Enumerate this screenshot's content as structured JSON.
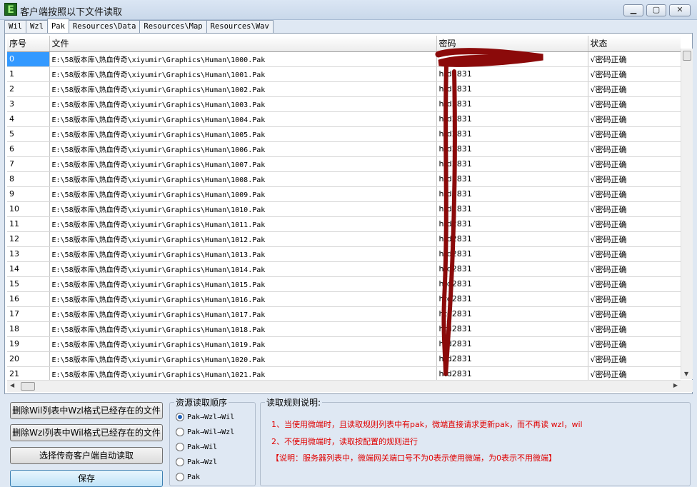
{
  "window": {
    "title": "客户端按照以下文件读取",
    "icon_letter": "E",
    "minimize_icon": "minimize-icon",
    "maximize_icon": "maximize-icon",
    "close_icon": "close-icon"
  },
  "tabs": [
    {
      "label": "Wil"
    },
    {
      "label": "Wzl"
    },
    {
      "label": "Pak",
      "active": true
    },
    {
      "label": "Resources\\Data"
    },
    {
      "label": "Resources\\Map"
    },
    {
      "label": "Resources\\Wav"
    }
  ],
  "grid": {
    "columns": [
      "序号",
      "文件",
      "密码",
      "状态"
    ],
    "rows": [
      {
        "idx": "0",
        "file": "E:\\58版本库\\热血传奇\\xiyumir\\Graphics\\Human\\1000.Pak",
        "pwd": "",
        "status": "√密码正确"
      },
      {
        "idx": "1",
        "file": "E:\\58版本库\\热血传奇\\xiyumir\\Graphics\\Human\\1001.Pak",
        "pwd": "htd2831",
        "status": "√密码正确"
      },
      {
        "idx": "2",
        "file": "E:\\58版本库\\热血传奇\\xiyumir\\Graphics\\Human\\1002.Pak",
        "pwd": "htd2831",
        "status": "√密码正确"
      },
      {
        "idx": "3",
        "file": "E:\\58版本库\\热血传奇\\xiyumir\\Graphics\\Human\\1003.Pak",
        "pwd": "htd2831",
        "status": "√密码正确"
      },
      {
        "idx": "4",
        "file": "E:\\58版本库\\热血传奇\\xiyumir\\Graphics\\Human\\1004.Pak",
        "pwd": "htd2831",
        "status": "√密码正确"
      },
      {
        "idx": "5",
        "file": "E:\\58版本库\\热血传奇\\xiyumir\\Graphics\\Human\\1005.Pak",
        "pwd": "htd2831",
        "status": "√密码正确"
      },
      {
        "idx": "6",
        "file": "E:\\58版本库\\热血传奇\\xiyumir\\Graphics\\Human\\1006.Pak",
        "pwd": "htd2831",
        "status": "√密码正确"
      },
      {
        "idx": "7",
        "file": "E:\\58版本库\\热血传奇\\xiyumir\\Graphics\\Human\\1007.Pak",
        "pwd": "htd2831",
        "status": "√密码正确"
      },
      {
        "idx": "8",
        "file": "E:\\58版本库\\热血传奇\\xiyumir\\Graphics\\Human\\1008.Pak",
        "pwd": "htd2831",
        "status": "√密码正确"
      },
      {
        "idx": "9",
        "file": "E:\\58版本库\\热血传奇\\xiyumir\\Graphics\\Human\\1009.Pak",
        "pwd": "htd2831",
        "status": "√密码正确"
      },
      {
        "idx": "10",
        "file": "E:\\58版本库\\热血传奇\\xiyumir\\Graphics\\Human\\1010.Pak",
        "pwd": "htd2831",
        "status": "√密码正确"
      },
      {
        "idx": "11",
        "file": "E:\\58版本库\\热血传奇\\xiyumir\\Graphics\\Human\\1011.Pak",
        "pwd": "htd2831",
        "status": "√密码正确"
      },
      {
        "idx": "12",
        "file": "E:\\58版本库\\热血传奇\\xiyumir\\Graphics\\Human\\1012.Pak",
        "pwd": "htd2831",
        "status": "√密码正确"
      },
      {
        "idx": "13",
        "file": "E:\\58版本库\\热血传奇\\xiyumir\\Graphics\\Human\\1013.Pak",
        "pwd": "htd2831",
        "status": "√密码正确"
      },
      {
        "idx": "14",
        "file": "E:\\58版本库\\热血传奇\\xiyumir\\Graphics\\Human\\1014.Pak",
        "pwd": "htd2831",
        "status": "√密码正确"
      },
      {
        "idx": "15",
        "file": "E:\\58版本库\\热血传奇\\xiyumir\\Graphics\\Human\\1015.Pak",
        "pwd": "htd2831",
        "status": "√密码正确"
      },
      {
        "idx": "16",
        "file": "E:\\58版本库\\热血传奇\\xiyumir\\Graphics\\Human\\1016.Pak",
        "pwd": "htd2831",
        "status": "√密码正确"
      },
      {
        "idx": "17",
        "file": "E:\\58版本库\\热血传奇\\xiyumir\\Graphics\\Human\\1017.Pak",
        "pwd": "htd2831",
        "status": "√密码正确"
      },
      {
        "idx": "18",
        "file": "E:\\58版本库\\热血传奇\\xiyumir\\Graphics\\Human\\1018.Pak",
        "pwd": "htd2831",
        "status": "√密码正确"
      },
      {
        "idx": "19",
        "file": "E:\\58版本库\\热血传奇\\xiyumir\\Graphics\\Human\\1019.Pak",
        "pwd": "htd2831",
        "status": "√密码正确"
      },
      {
        "idx": "20",
        "file": "E:\\58版本库\\热血传奇\\xiyumir\\Graphics\\Human\\1020.Pak",
        "pwd": "htd2831",
        "status": "√密码正确"
      },
      {
        "idx": "21",
        "file": "E:\\58版本库\\热血传奇\\xiyumir\\Graphics\\Human\\1021.Pak",
        "pwd": "htd2831",
        "status": "√密码正确"
      }
    ]
  },
  "buttons": {
    "delete_wil": "删除Wil列表中Wzl格式已经存在的文件",
    "delete_wzl": "删除Wzl列表中Wil格式已经存在的文件",
    "select_client": "选择传奇客户端自动读取",
    "save": "保存"
  },
  "order_group": {
    "title": "资源读取顺序",
    "options": [
      {
        "label": "Pak→Wzl→Wil",
        "checked": true
      },
      {
        "label": "Pak→Wil→Wzl",
        "checked": false
      },
      {
        "label": "Pak→Wil",
        "checked": false
      },
      {
        "label": "Pak→Wzl",
        "checked": false
      },
      {
        "label": "Pak",
        "checked": false
      }
    ]
  },
  "rules_group": {
    "title": "读取规则说明:",
    "lines": [
      "1、当使用微端时，且读取规则列表中有pak，微端直接请求更新pak，而不再读 wzl，wil",
      "2、不使用微端时，读取按配置的规则进行",
      "【说明：服务器列表中，微端网关端口号不为0表示使用微端，为0表示不用微端】"
    ]
  },
  "colors": {
    "selection": "#3399ff",
    "rule_text": "#e00000",
    "scribble": "#8b0a0a"
  }
}
